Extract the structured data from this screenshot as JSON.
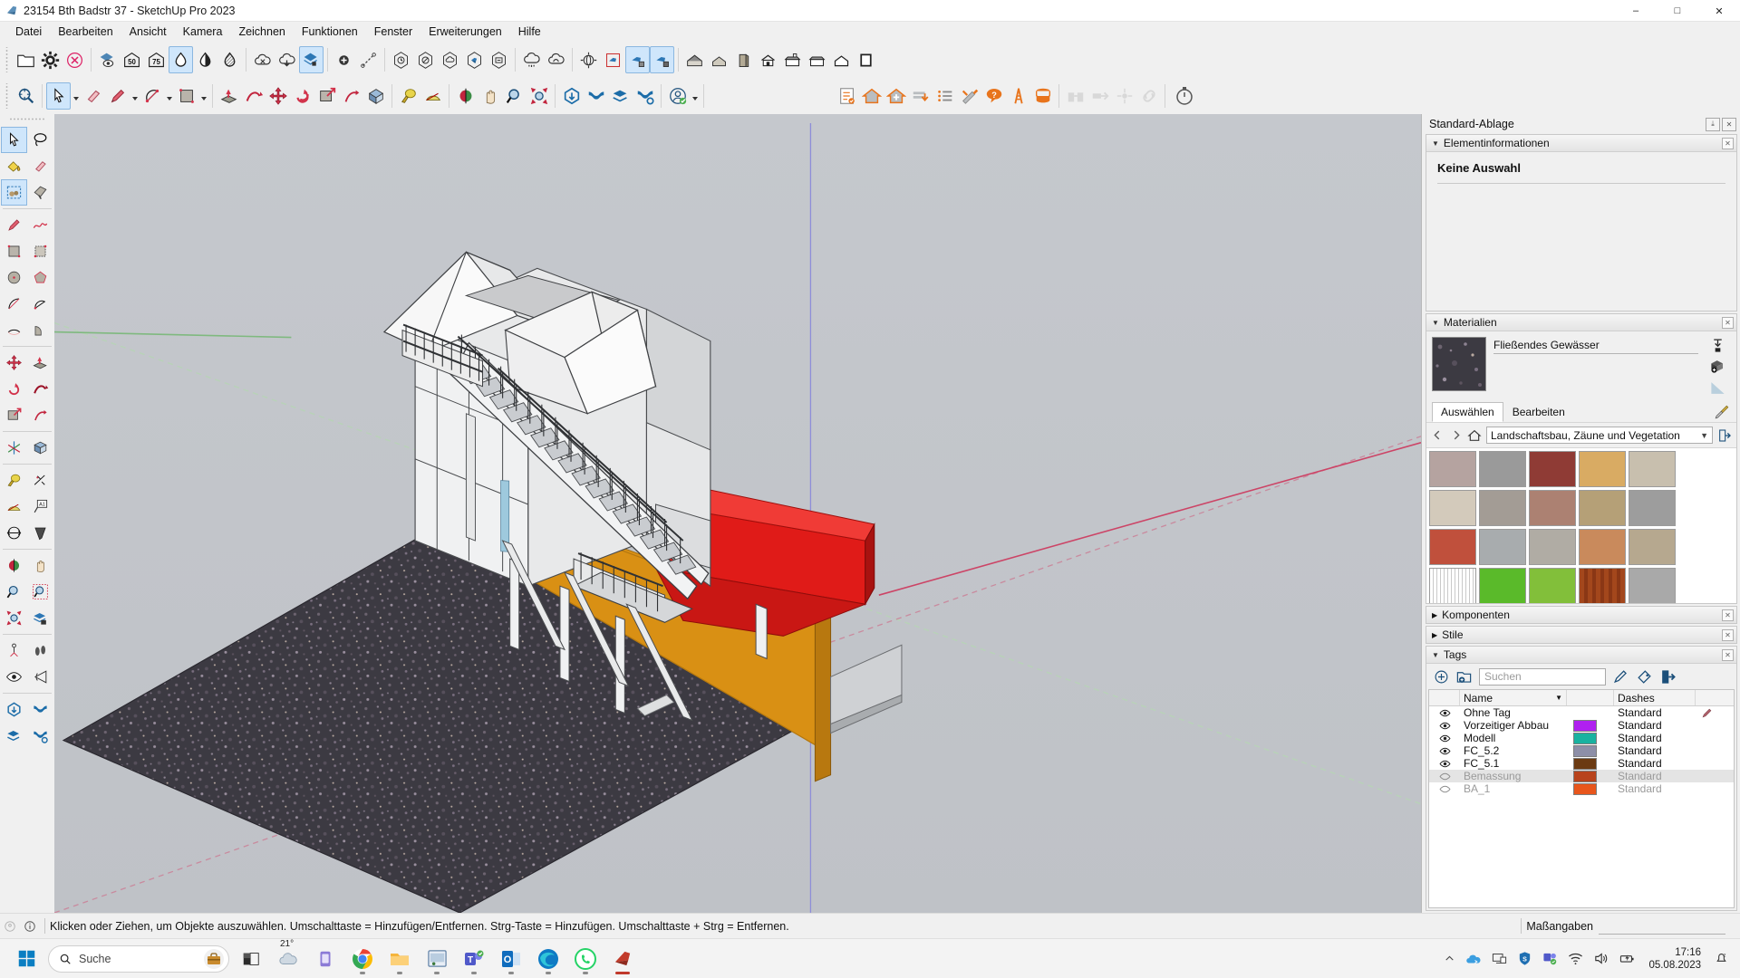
{
  "window": {
    "title": "23154 Bth Badstr 37 - SketchUp Pro 2023",
    "app_icon": "sketchup-logo-icon",
    "minimize": "–",
    "maximize": "□",
    "close": "✕"
  },
  "menubar": {
    "items": [
      {
        "label": "Datei",
        "name": "menu-datei"
      },
      {
        "label": "Bearbeiten",
        "name": "menu-bearbeiten"
      },
      {
        "label": "Ansicht",
        "name": "menu-ansicht"
      },
      {
        "label": "Kamera",
        "name": "menu-kamera"
      },
      {
        "label": "Zeichnen",
        "name": "menu-zeichnen"
      },
      {
        "label": "Funktionen",
        "name": "menu-funktionen"
      },
      {
        "label": "Fenster",
        "name": "menu-fenster"
      },
      {
        "label": "Erweiterungen",
        "name": "menu-erweiterungen"
      },
      {
        "label": "Hilfe",
        "name": "menu-hilfe"
      }
    ]
  },
  "toolbar_row1": {
    "groups": [
      {
        "items": [
          {
            "name": "open-folder-icon",
            "icon": "folder"
          },
          {
            "name": "settings-gear-icon",
            "icon": "gear"
          },
          {
            "name": "cancel-icon",
            "icon": "cancel"
          }
        ]
      },
      {
        "items": [
          {
            "name": "section-view-icon",
            "icon": "layers-eye"
          },
          {
            "name": "scale-50-icon",
            "icon": "n50"
          },
          {
            "name": "scale-75-icon",
            "icon": "n75"
          },
          {
            "name": "fog-icon",
            "icon": "drop-outline",
            "active": true
          },
          {
            "name": "shadow-icon",
            "icon": "drop-half"
          },
          {
            "name": "hatch-icon",
            "icon": "drop-hatch"
          }
        ]
      },
      {
        "items": [
          {
            "name": "cloud-off-icon",
            "icon": "cloud-x"
          },
          {
            "name": "cloud-download-icon",
            "icon": "cloud-down"
          },
          {
            "name": "layers-hand-icon",
            "icon": "layers-hand",
            "active": true
          }
        ]
      },
      {
        "items": [
          {
            "name": "add-circle-icon",
            "icon": "plus-circle"
          },
          {
            "name": "dimension-line-icon",
            "icon": "dim-line"
          }
        ]
      },
      {
        "items": [
          {
            "name": "view-history-icon",
            "icon": "hex-clock"
          },
          {
            "name": "view-ban-icon",
            "icon": "hex-ban"
          },
          {
            "name": "view-cloud-icon",
            "icon": "hex-cloud"
          },
          {
            "name": "view-model-icon",
            "icon": "hex-model"
          },
          {
            "name": "view-export-icon",
            "icon": "hex-export"
          }
        ]
      },
      {
        "items": [
          {
            "name": "cloud-rain-icon",
            "icon": "cloud-rain"
          },
          {
            "name": "cloud-sync-icon",
            "icon": "cloud-sync"
          }
        ]
      },
      {
        "items": [
          {
            "name": "orbit-globe-icon",
            "icon": "globe-arrows"
          },
          {
            "name": "model-plane-icon",
            "icon": "cube-plane"
          },
          {
            "name": "model-place-a-icon",
            "icon": "cube-place",
            "active": true
          },
          {
            "name": "model-place-b-icon",
            "icon": "cube-place2",
            "active": true
          }
        ]
      },
      {
        "items": [
          {
            "name": "house-view-icon",
            "icon": "house-dark"
          },
          {
            "name": "house-iso-icon",
            "icon": "house-iso"
          },
          {
            "name": "box-icon",
            "icon": "box-tall"
          },
          {
            "name": "house-front-icon",
            "icon": "house-front"
          },
          {
            "name": "house-top-icon",
            "icon": "house-top"
          },
          {
            "name": "house-side-icon",
            "icon": "house-side"
          },
          {
            "name": "house-gable-icon",
            "icon": "house-gable"
          },
          {
            "name": "rect-view-icon",
            "icon": "rect-view"
          }
        ]
      }
    ]
  },
  "toolbar_row2": {
    "groups": [
      {
        "items": [
          {
            "name": "zoom-target-icon",
            "icon": "zoom-target"
          }
        ]
      },
      {
        "items": [
          {
            "name": "select-tool-icon",
            "icon": "arrow-select",
            "active": true,
            "caret": true
          },
          {
            "name": "eraser-tool-icon",
            "icon": "eraser"
          },
          {
            "name": "pencil-tool-icon",
            "icon": "pencil",
            "caret": true
          },
          {
            "name": "arc-tool-icon",
            "icon": "arc",
            "caret": true
          },
          {
            "name": "rectangle-tool-icon",
            "icon": "rect",
            "caret": true
          }
        ]
      },
      {
        "items": [
          {
            "name": "pushpull-tool-icon",
            "icon": "pushpull"
          },
          {
            "name": "followme-tool-icon",
            "icon": "followme"
          },
          {
            "name": "move-tool-icon",
            "icon": "move"
          },
          {
            "name": "rotate-tool-icon",
            "icon": "rotate"
          },
          {
            "name": "scale-tool-icon",
            "icon": "scale"
          },
          {
            "name": "offset-tool-icon",
            "icon": "offset"
          }
        ]
      },
      {
        "items": [
          {
            "name": "tape-measure-icon",
            "icon": "tape"
          },
          {
            "name": "protractor-icon",
            "icon": "protractor"
          }
        ]
      },
      {
        "items": [
          {
            "name": "orbit-tool-icon",
            "icon": "orbit"
          },
          {
            "name": "pan-tool-icon",
            "icon": "pan"
          },
          {
            "name": "zoom-tool-icon",
            "icon": "magnify"
          },
          {
            "name": "zoom-extents-icon",
            "icon": "zoom-extents"
          }
        ]
      },
      {
        "items": [
          {
            "name": "solid-tools-icon",
            "icon": "solid-down"
          },
          {
            "name": "intersect-icon",
            "icon": "cross-blue"
          },
          {
            "name": "layers-arrow-icon",
            "icon": "layers-arrow"
          },
          {
            "name": "cross-gear-icon",
            "icon": "cross-gear"
          }
        ]
      },
      {
        "items": [
          {
            "name": "account-avatar-icon",
            "icon": "avatar-check",
            "caret": true
          }
        ]
      },
      {
        "items": [
          {
            "name": "checklist-icon",
            "icon": "checklist"
          },
          {
            "name": "house-orange-icon",
            "icon": "house-orange"
          },
          {
            "name": "house-add-icon",
            "icon": "house-add"
          },
          {
            "name": "import-stack-icon",
            "icon": "stack-down"
          },
          {
            "name": "list-icon",
            "icon": "list-lines"
          },
          {
            "name": "tools-icon",
            "icon": "tools-cross"
          },
          {
            "name": "help-bubble-icon",
            "icon": "help-bubble"
          },
          {
            "name": "ladder-icon",
            "icon": "ladder"
          },
          {
            "name": "database-icon",
            "icon": "database"
          }
        ]
      },
      {
        "items": [
          {
            "name": "binoculars-icon",
            "icon": "binoculars",
            "disabled": true
          },
          {
            "name": "transfer-icon",
            "icon": "transfer",
            "disabled": true
          },
          {
            "name": "node-icon",
            "icon": "node",
            "disabled": true
          },
          {
            "name": "link-icon",
            "icon": "link",
            "disabled": true
          }
        ]
      },
      {
        "items": [
          {
            "name": "stopwatch-icon",
            "icon": "stopwatch"
          }
        ]
      }
    ]
  },
  "left_toolbar": {
    "groups": [
      [
        "arrow-select-icon",
        "lasso-select-icon",
        "paint-bucket-icon",
        "eraser-icon",
        "component-box-icon",
        "tag-tool-icon"
      ],
      [
        "pencil-icon",
        "freehand-icon",
        "rectangle-icon",
        "rotated-rectangle-icon",
        "circle-icon",
        "polygon-icon",
        "arc-icon",
        "pie-arc-icon",
        "two-point-arc-icon",
        "three-point-arc-icon"
      ],
      [
        "move-icon",
        "pushpull-icon",
        "rotate-icon",
        "followme-icon",
        "scale-icon",
        "offset-icon"
      ],
      [
        "axes-icon",
        "section-plane-icon"
      ],
      [
        "tape-measure-icon",
        "dimension-icon",
        "protractor-icon",
        "text-label-icon",
        "dimension-arrow-icon",
        "tornado-icon"
      ],
      [
        "orbit-icon",
        "pan-icon",
        "zoom-icon",
        "zoom-window-icon",
        "zoom-extents-icon",
        "previous-view-icon"
      ],
      [
        "position-camera-icon",
        "walk-icon",
        "look-around-icon",
        "field-of-view-icon"
      ],
      [
        "solid-down-icon",
        "cross-blue-icon",
        "layers-arrow-icon",
        "cross-gear-icon"
      ]
    ]
  },
  "viewport": {
    "model_name": "exterior-staircase-building",
    "background_color": "#c3c6cb",
    "ground_material": "Fließendes Gewässer",
    "colors": {
      "wall_orange": "#d99014",
      "accent_red": "#e01b18",
      "roof_white": "#f3f3f3",
      "axis_green": "#8fc98f",
      "axis_red": "#d05a6e",
      "axis_blue": "#7f7fcf"
    }
  },
  "right_panel": {
    "title": "Standard-Ablage",
    "element_info": {
      "heading": "Elementinformationen",
      "no_selection": "Keine Auswahl"
    },
    "materials": {
      "heading": "Materialien",
      "current_name": "Fließendes Gewässer",
      "tabs": [
        {
          "label": "Auswählen",
          "selected": true
        },
        {
          "label": "Bearbeiten",
          "selected": false
        }
      ],
      "library": "Landschaftsbau, Zäune und Vegetation",
      "swatch_colors": [
        "#b5a3a0",
        "#9a9a9a",
        "#8f3b35",
        "#d9ab63",
        "#c8bfae",
        "#d3cabb",
        "#a39c95",
        "#ac8172",
        "#b5a077",
        "#9d9d9d",
        "#c0503c",
        "#a8acae",
        "#b0aca4",
        "#c98a5c",
        "#b6a88f",
        "#e2e2e2",
        "#5aba2a",
        "#82bf3a",
        "#a3471c",
        "#a9a9a9"
      ]
    },
    "components": {
      "heading": "Komponenten"
    },
    "styles": {
      "heading": "Stile"
    },
    "tags": {
      "heading": "Tags",
      "search_placeholder": "Suchen",
      "columns": [
        "Name",
        "Dashes"
      ],
      "rows": [
        {
          "name": "Ohne Tag",
          "dashes": "Standard",
          "color": null,
          "visible": true,
          "dim": false,
          "highlight": false,
          "pencil": true
        },
        {
          "name": "Vorzeitiger Abbau",
          "dashes": "Standard",
          "color": "#b020f0",
          "visible": true,
          "dim": false,
          "highlight": false,
          "pencil": false
        },
        {
          "name": "Modell",
          "dashes": "Standard",
          "color": "#19b2a0",
          "visible": true,
          "dim": false,
          "highlight": false,
          "pencil": false
        },
        {
          "name": "FC_5.2",
          "dashes": "Standard",
          "color": "#8d8fa8",
          "visible": true,
          "dim": false,
          "highlight": false,
          "pencil": false
        },
        {
          "name": "FC_5.1",
          "dashes": "Standard",
          "color": "#6b3a12",
          "visible": true,
          "dim": false,
          "highlight": false,
          "pencil": false
        },
        {
          "name": "Bemassung",
          "dashes": "Standard",
          "color": "#b8431c",
          "visible": false,
          "dim": true,
          "highlight": true,
          "pencil": false
        },
        {
          "name": "BA_1",
          "dashes": "Standard",
          "color": "#e8561c",
          "visible": false,
          "dim": true,
          "highlight": false,
          "pencil": false
        }
      ]
    }
  },
  "statusbar": {
    "hint": "Klicken oder Ziehen, um Objekte auszuwählen. Umschalttaste = Hinzufügen/Entfernen. Strg-Taste = Hinzufügen. Umschalttaste + Strg = Entfernen.",
    "measurement_label": "Maßangaben",
    "measurement_value": ""
  },
  "taskbar": {
    "search_placeholder": "Suche",
    "weather_temp": "21°",
    "apps": [
      {
        "name": "taskbar-file-explorer-dark",
        "icon": "explorer-dark"
      },
      {
        "name": "taskbar-weather",
        "icon": "weather"
      },
      {
        "name": "taskbar-media",
        "icon": "media-purple"
      },
      {
        "name": "taskbar-chrome",
        "icon": "chrome"
      },
      {
        "name": "taskbar-file-explorer",
        "icon": "folder-yellow"
      },
      {
        "name": "taskbar-app-window",
        "icon": "app-window"
      },
      {
        "name": "taskbar-teams",
        "icon": "teams"
      },
      {
        "name": "taskbar-outlook",
        "icon": "outlook"
      },
      {
        "name": "taskbar-edge",
        "icon": "edge"
      },
      {
        "name": "taskbar-whatsapp",
        "icon": "whatsapp"
      },
      {
        "name": "taskbar-sketchup",
        "icon": "sketchup"
      }
    ],
    "tray": [
      {
        "name": "tray-chevron-up-icon",
        "icon": "chevron-up"
      },
      {
        "name": "tray-onedrive-icon",
        "icon": "onedrive"
      },
      {
        "name": "tray-remote-desktop-icon",
        "icon": "remote"
      },
      {
        "name": "tray-security-icon",
        "icon": "shield-blue"
      },
      {
        "name": "tray-teams-icon",
        "icon": "teams-small"
      },
      {
        "name": "tray-wifi-icon",
        "icon": "wifi"
      },
      {
        "name": "tray-volume-icon",
        "icon": "volume"
      },
      {
        "name": "tray-battery-icon",
        "icon": "battery"
      }
    ],
    "time": "17:16",
    "date": "05.08.2023",
    "notification_icon": "bell-sleep-icon"
  }
}
